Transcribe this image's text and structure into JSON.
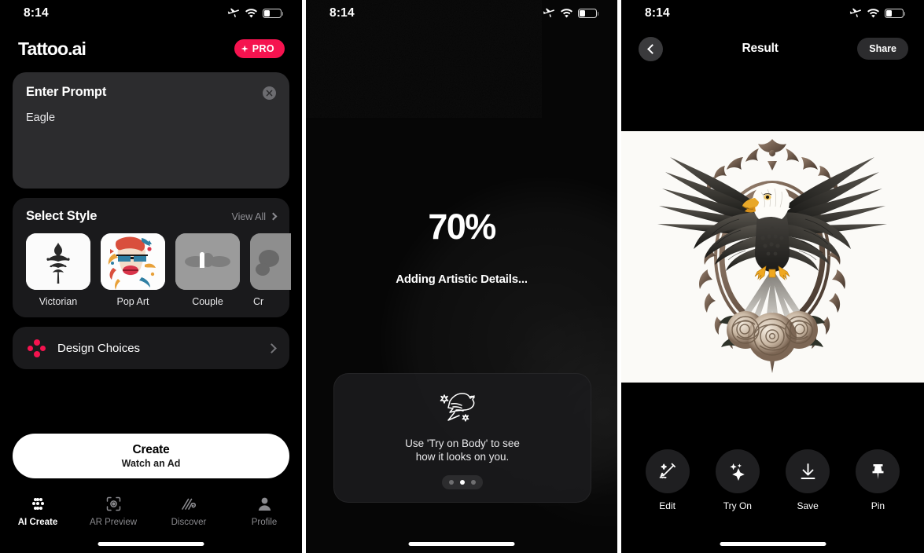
{
  "statusbar": {
    "time": "8:14",
    "icons": [
      "airplane-mode-icon",
      "wifi-icon",
      "battery-icon"
    ]
  },
  "panel_create": {
    "brand": "Tattoo.ai",
    "pro_badge": {
      "label": "PRO",
      "icon": "sparkle-diamond-icon",
      "color": "#F5134F"
    },
    "prompt": {
      "title": "Enter Prompt",
      "value": "Eagle",
      "placeholder": "Enter Prompt",
      "clear_icon": "clear-circle-icon"
    },
    "style": {
      "title": "Select Style",
      "view_all": "View All",
      "items": [
        {
          "label": "Victorian",
          "locked": false,
          "thumb": "victorian-ornament-thumb"
        },
        {
          "label": "Pop Art",
          "locked": false,
          "thumb": "pop-art-face-thumb"
        },
        {
          "label": "Couple",
          "locked": true,
          "thumb": "couple-blurred-thumb"
        },
        {
          "label": "Cr",
          "locked": true,
          "thumb": "cropped-blurred-thumb"
        }
      ]
    },
    "design_choices": {
      "label": "Design Choices",
      "icon": "four-dot-cluster-icon",
      "accent": "#F5134F"
    },
    "create": {
      "title": "Create",
      "subtitle": "Watch an Ad"
    },
    "tabs": [
      {
        "label": "AI Create",
        "icon": "dot-grid-icon",
        "active": true
      },
      {
        "label": "AR Preview",
        "icon": "viewfinder-icon",
        "active": false
      },
      {
        "label": "Discover",
        "icon": "squiggle-icon",
        "active": false
      },
      {
        "label": "Profile",
        "icon": "person-icon",
        "active": false
      }
    ]
  },
  "panel_loading": {
    "percent": "70%",
    "status": "Adding Artistic Details...",
    "tip": {
      "icon": "swallow-bird-icon",
      "line1": "Use 'Try on Body' to see",
      "line2": "how it looks on you.",
      "page_count": 3,
      "page_active": 2
    }
  },
  "panel_result": {
    "title": "Result",
    "back_icon": "chevron-left-icon",
    "share_label": "Share",
    "artwork": "eagle-ornate-frame-roses-tattoo",
    "actions": [
      {
        "label": "Edit",
        "icon": "magic-wand-icon"
      },
      {
        "label": "Try On",
        "icon": "sparkles-icon"
      },
      {
        "label": "Save",
        "icon": "download-icon"
      },
      {
        "label": "Pin",
        "icon": "pushpin-icon"
      }
    ]
  }
}
